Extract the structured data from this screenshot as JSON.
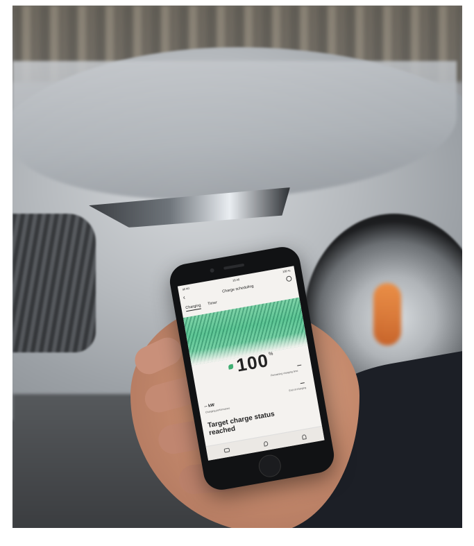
{
  "phone_app": {
    "statusbar": {
      "carrier": "all 4G",
      "time": "16:40",
      "battery": "100 %"
    },
    "header": {
      "title": "Charge scheduling"
    },
    "tabs": [
      {
        "label": "Charging",
        "active": true
      },
      {
        "label": "Timer",
        "active": false
      }
    ],
    "charge": {
      "percent": "100",
      "unit": "%"
    },
    "labels": {
      "remaining_time": "Remaining charging time",
      "end_of_charging": "End of charging",
      "kw_value": "-- kW",
      "charging_performance": "Charging performance"
    },
    "status_message": "Target charge status reached",
    "nav_icons": [
      "car-icon",
      "location-icon",
      "notification-icon"
    ],
    "colors": {
      "charge_green": "#5fc796",
      "accent_green": "#3fae72"
    }
  }
}
